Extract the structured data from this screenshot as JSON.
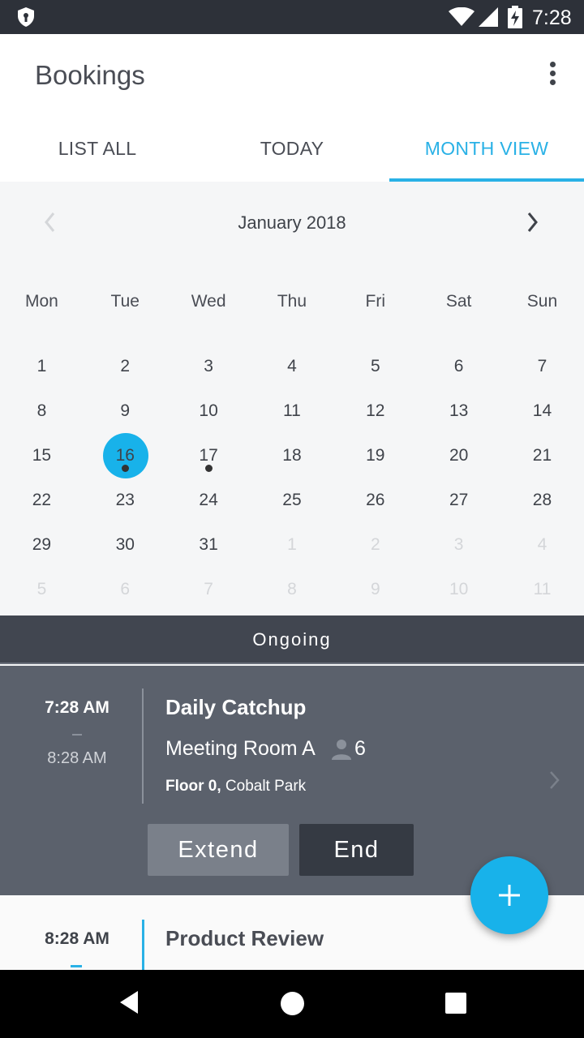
{
  "status_bar": {
    "time": "7:28"
  },
  "app_bar": {
    "title": "Bookings"
  },
  "tabs": [
    {
      "label": "LIST ALL",
      "active": false
    },
    {
      "label": "TODAY",
      "active": false
    },
    {
      "label": "MONTH VIEW",
      "active": true
    }
  ],
  "calendar": {
    "month_label": "January 2018",
    "weekdays": [
      "Mon",
      "Tue",
      "Wed",
      "Thu",
      "Fri",
      "Sat",
      "Sun"
    ],
    "weeks": [
      [
        "1",
        "2",
        "3",
        "4",
        "5",
        "6",
        "7"
      ],
      [
        "8",
        "9",
        "10",
        "11",
        "12",
        "13",
        "14"
      ],
      [
        "15",
        "16",
        "17",
        "18",
        "19",
        "20",
        "21"
      ],
      [
        "22",
        "23",
        "24",
        "25",
        "26",
        "27",
        "28"
      ],
      [
        "29",
        "30",
        "31",
        "1",
        "2",
        "3",
        "4"
      ],
      [
        "5",
        "6",
        "7",
        "8",
        "9",
        "10",
        "11"
      ]
    ],
    "selected_day": "16",
    "days_with_events": [
      "16",
      "17"
    ]
  },
  "section_header": "Ongoing",
  "ongoing_booking": {
    "start_time": "7:28 AM",
    "end_time": "8:28 AM",
    "name": "Daily Catchup",
    "room": "Meeting Room A",
    "capacity": "6",
    "floor": "Floor 0,",
    "building": "Cobalt Park",
    "extend_label": "Extend",
    "end_label": "End"
  },
  "next_booking": {
    "start_time": "8:28 AM",
    "name": "Product Review"
  },
  "colors": {
    "accent": "#18b2ea",
    "card_bg": "#5b616c",
    "header_dark": "#414650"
  }
}
